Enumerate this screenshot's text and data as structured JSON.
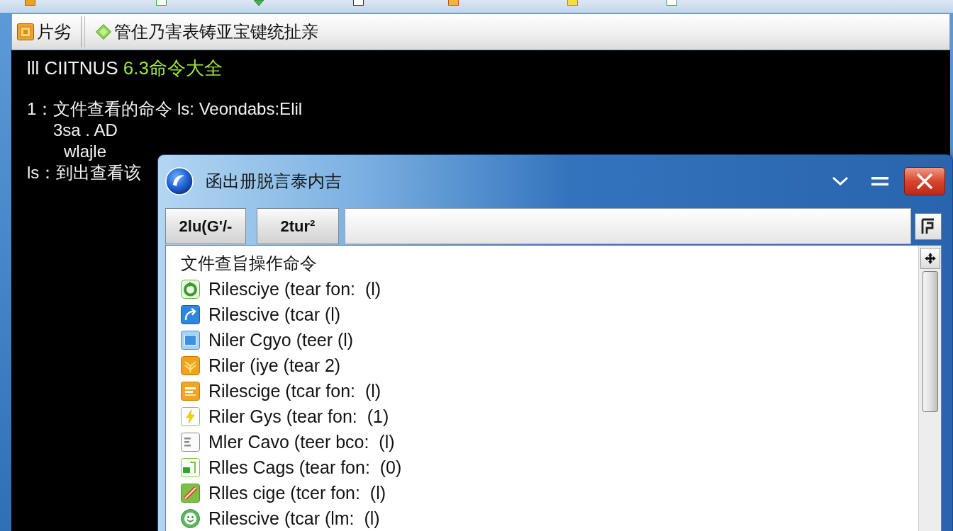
{
  "toolbar": {
    "buttons": [
      {
        "kind": "box",
        "label": "片劣"
      },
      {
        "kind": "diamond",
        "label": "管住乃害表铸亚宝键统扯亲"
      }
    ]
  },
  "console": {
    "lines": [
      {
        "kind": "title",
        "segments": [
          {
            "kind": "plain",
            "text": "lll CIITNUS "
          },
          {
            "kind": "accent",
            "text": "6.3命令大全"
          }
        ]
      },
      {
        "kind": "entry",
        "segments": [
          {
            "kind": "plain",
            "text": "1：文件查看的命令 ls: Veondabs:Elil"
          }
        ]
      },
      {
        "kind": "wrap",
        "segments": [
          {
            "kind": "plain",
            "text": "3sa . AD"
          }
        ]
      },
      {
        "kind": "subwrap",
        "segments": [
          {
            "kind": "plain",
            "text": "wlajle"
          }
        ]
      },
      {
        "kind": "entry",
        "segments": [
          {
            "kind": "plain",
            "text": "ls：到出查看该"
          }
        ]
      }
    ]
  },
  "dialog": {
    "title": "函出册脱言泰内吉",
    "tabs": [
      {
        "label": "2lu(G'/-",
        "selected": false
      },
      {
        "label": "2tur²",
        "selected": false
      }
    ],
    "list": {
      "heading": "文件查旨操作命令",
      "items": [
        {
          "kind": "ring",
          "label": "Rilesciye (tear fon:  (l)",
          "selected": false
        },
        {
          "kind": "swirl",
          "label": "Rilescive (tcar (l)",
          "selected": false
        },
        {
          "kind": "window",
          "label": "Niler Cgyo (teer (l)",
          "selected": false
        },
        {
          "kind": "shield",
          "label": "Riler (iye (tear 2)",
          "selected": false
        },
        {
          "kind": "tray",
          "label": "Rilescige (tcar fon:  (l)",
          "selected": false
        },
        {
          "kind": "bolt",
          "label": "Riler Gys (tear fon:  (1)",
          "selected": false
        },
        {
          "kind": "page",
          "label": "Mler Cavo (teer bco:  (l)",
          "selected": false
        },
        {
          "kind": "tab",
          "label": "Rlles Cags (tear fon:  (0)",
          "selected": false
        },
        {
          "kind": "stripe",
          "label": "Rlles cige (tcer fon:  (l)",
          "selected": false
        },
        {
          "kind": "smile",
          "label": "Rilescive (tcar (lm:  (l)",
          "selected": false
        }
      ]
    }
  }
}
